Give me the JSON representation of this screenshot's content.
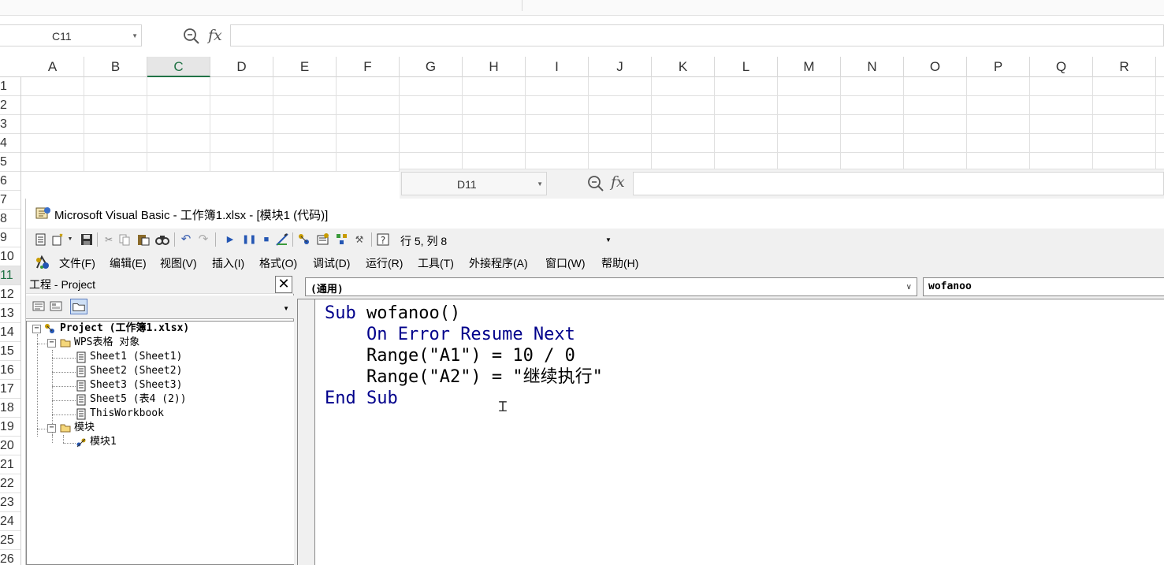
{
  "spreadsheet": {
    "name_box": "C11",
    "fx_label": "fx",
    "columns": [
      "A",
      "B",
      "C",
      "D",
      "E",
      "F",
      "G",
      "H",
      "I",
      "J",
      "K",
      "L",
      "M",
      "N",
      "O",
      "P",
      "Q",
      "R"
    ],
    "active_column": "C",
    "rows": [
      "1",
      "2",
      "3",
      "4",
      "5",
      "6",
      "7",
      "8",
      "9",
      "10",
      "11",
      "12",
      "13",
      "14",
      "15",
      "16",
      "17",
      "18",
      "19",
      "20",
      "21",
      "22",
      "23",
      "24",
      "25",
      "26"
    ],
    "active_row": "11"
  },
  "secondary_formula_bar": {
    "name_box": "D11",
    "fx_label": "fx"
  },
  "vbe": {
    "title": "Microsoft Visual Basic - 工作簿1.xlsx - [模块1 (代码)]",
    "toolbar_status": "行 5, 列 8",
    "menus": [
      "文件(F)",
      "编辑(E)",
      "视图(V)",
      "插入(I)",
      "格式(O)",
      "调试(D)",
      "运行(R)",
      "工具(T)",
      "外接程序(A)",
      "窗口(W)",
      "帮助(H)"
    ],
    "project_panel": {
      "title": "工程 - Project",
      "close": "✕",
      "tree": {
        "project": "Project (工作簿1.xlsx)",
        "objects_folder": "WPS表格 对象",
        "sheets": [
          "Sheet1 (Sheet1)",
          "Sheet2 (Sheet2)",
          "Sheet3 (Sheet3)",
          "Sheet5 (表4 (2))",
          "ThisWorkbook"
        ],
        "modules_folder": "模块",
        "modules": [
          "模块1"
        ]
      }
    },
    "code_window": {
      "object_combo": "(通用)",
      "proc_combo": "wofanoo",
      "lines": [
        {
          "kw": "Sub",
          "rest": " wofanoo()"
        },
        {
          "indent": "    ",
          "kw": "On Error Resume Next",
          "rest": ""
        },
        {
          "indent": "    ",
          "kw": "",
          "rest": "Range(\"A1\") = 10 / 0"
        },
        {
          "indent": "    ",
          "kw": "",
          "rest": "Range(\"A2\") = \"继续执行\""
        },
        {
          "kw": "End Sub",
          "rest": ""
        }
      ]
    }
  },
  "colors": {
    "keyword": "#00008b",
    "active_header": "#217346"
  }
}
